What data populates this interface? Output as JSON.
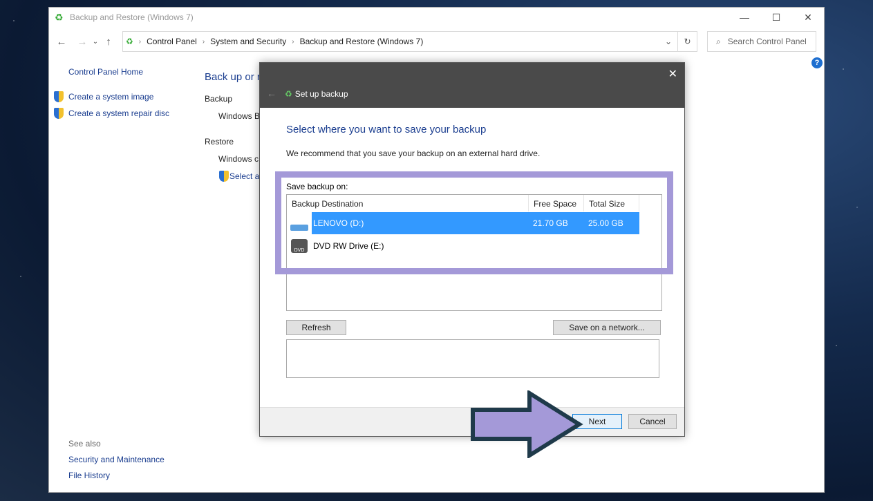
{
  "window": {
    "title": "Backup and Restore (Windows 7)",
    "minimize": "—",
    "maximize": "☐",
    "close": "✕"
  },
  "nav": {
    "back": "←",
    "forward": "→",
    "recent": "⌄",
    "up": "↑",
    "breadcrumb": [
      "Control Panel",
      "System and Security",
      "Backup and Restore (Windows 7)"
    ],
    "refresh": "↻",
    "search_placeholder": "Search Control Panel",
    "help": "?"
  },
  "sidebar": {
    "home": "Control Panel Home",
    "items": [
      {
        "label": "Create a system image"
      },
      {
        "label": "Create a system repair disc"
      }
    ],
    "see_also": "See also",
    "links": [
      "Security and Maintenance",
      "File History"
    ]
  },
  "main": {
    "heading": "Back up or r",
    "backup_label": "Backup",
    "backup_text": "Windows B",
    "restore_label": "Restore",
    "restore_text": "Windows c",
    "restore_link": "Select ar"
  },
  "dialog": {
    "title": "Set up backup",
    "close": "✕",
    "back": "←",
    "heading": "Select where you want to save your backup",
    "recommend": "We recommend that you save your backup on an external hard drive.",
    "save_on": "Save backup on:",
    "columns": [
      "Backup Destination",
      "Free Space",
      "Total Size"
    ],
    "rows": [
      {
        "name": "LENOVO (D:)",
        "free": "21.70 GB",
        "total": "25.00 GB",
        "selected": true,
        "icon": "hard-drive-icon"
      },
      {
        "name": "DVD RW Drive (E:)",
        "free": "",
        "total": "",
        "selected": false,
        "icon": "dvd-drive-icon",
        "dvd_text": "DVD"
      }
    ],
    "refresh": "Refresh",
    "network": "Save on a network...",
    "next": "Next",
    "cancel": "Cancel"
  },
  "colors": {
    "highlight": "#a499d8",
    "selection": "#3399ff",
    "link": "#1a3d8f"
  }
}
